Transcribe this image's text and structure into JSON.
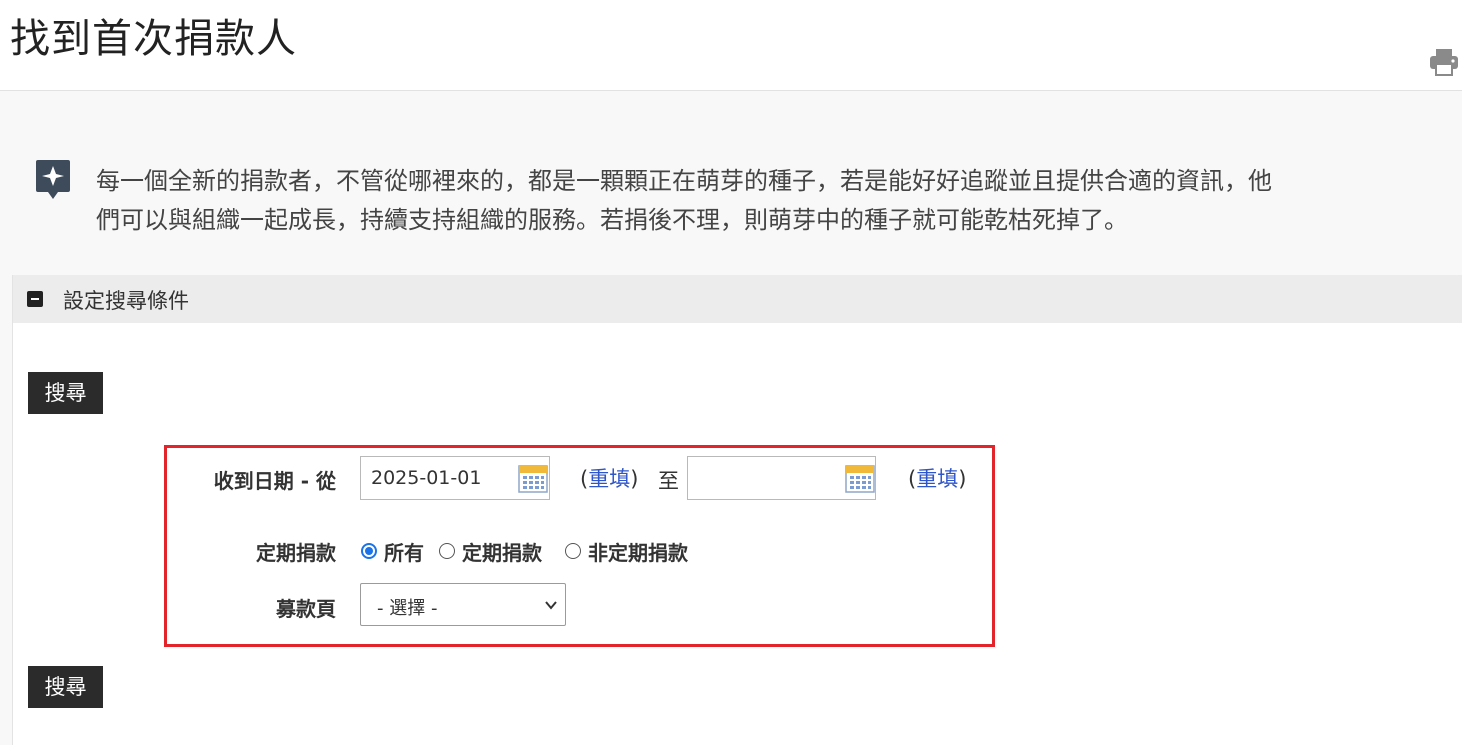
{
  "header": {
    "title": "找到首次捐款人"
  },
  "intro": {
    "line1": "每一個全新的捐款者，不管從哪裡來的，都是一顆顆正在萌芽的種子，若是能好好追蹤並且提供合適的資訊，他",
    "line2": "們可以與組織一起成長，持續支持組織的服務。若捐後不理，則萌芽中的種子就可能乾枯死掉了。"
  },
  "search_panel": {
    "title": "設定搜尋條件",
    "search_button_top": "搜尋",
    "search_button_bottom": "搜尋",
    "received_date": {
      "label": "收到日期 - 從",
      "from_value": "2025-01-01",
      "to_value": "",
      "reset_label": "重填",
      "to_label": "至",
      "paren_open": "(",
      "paren_close": ")"
    },
    "recurring": {
      "label": "定期捐款",
      "options": [
        "所有",
        "定期捐款",
        "非定期捐款"
      ],
      "selected": "所有"
    },
    "campaign_page": {
      "label": "募款頁",
      "selected": "- 選擇 -"
    }
  },
  "colors": {
    "highlight_border": "#e3242b",
    "link": "#2f56c8",
    "button_bg": "#2b2b2b",
    "radio_accent": "#1a73e8"
  },
  "icons": [
    "print-icon",
    "sparkle-icon",
    "collapse-icon",
    "calendar-icon",
    "chevron-down-icon"
  ]
}
